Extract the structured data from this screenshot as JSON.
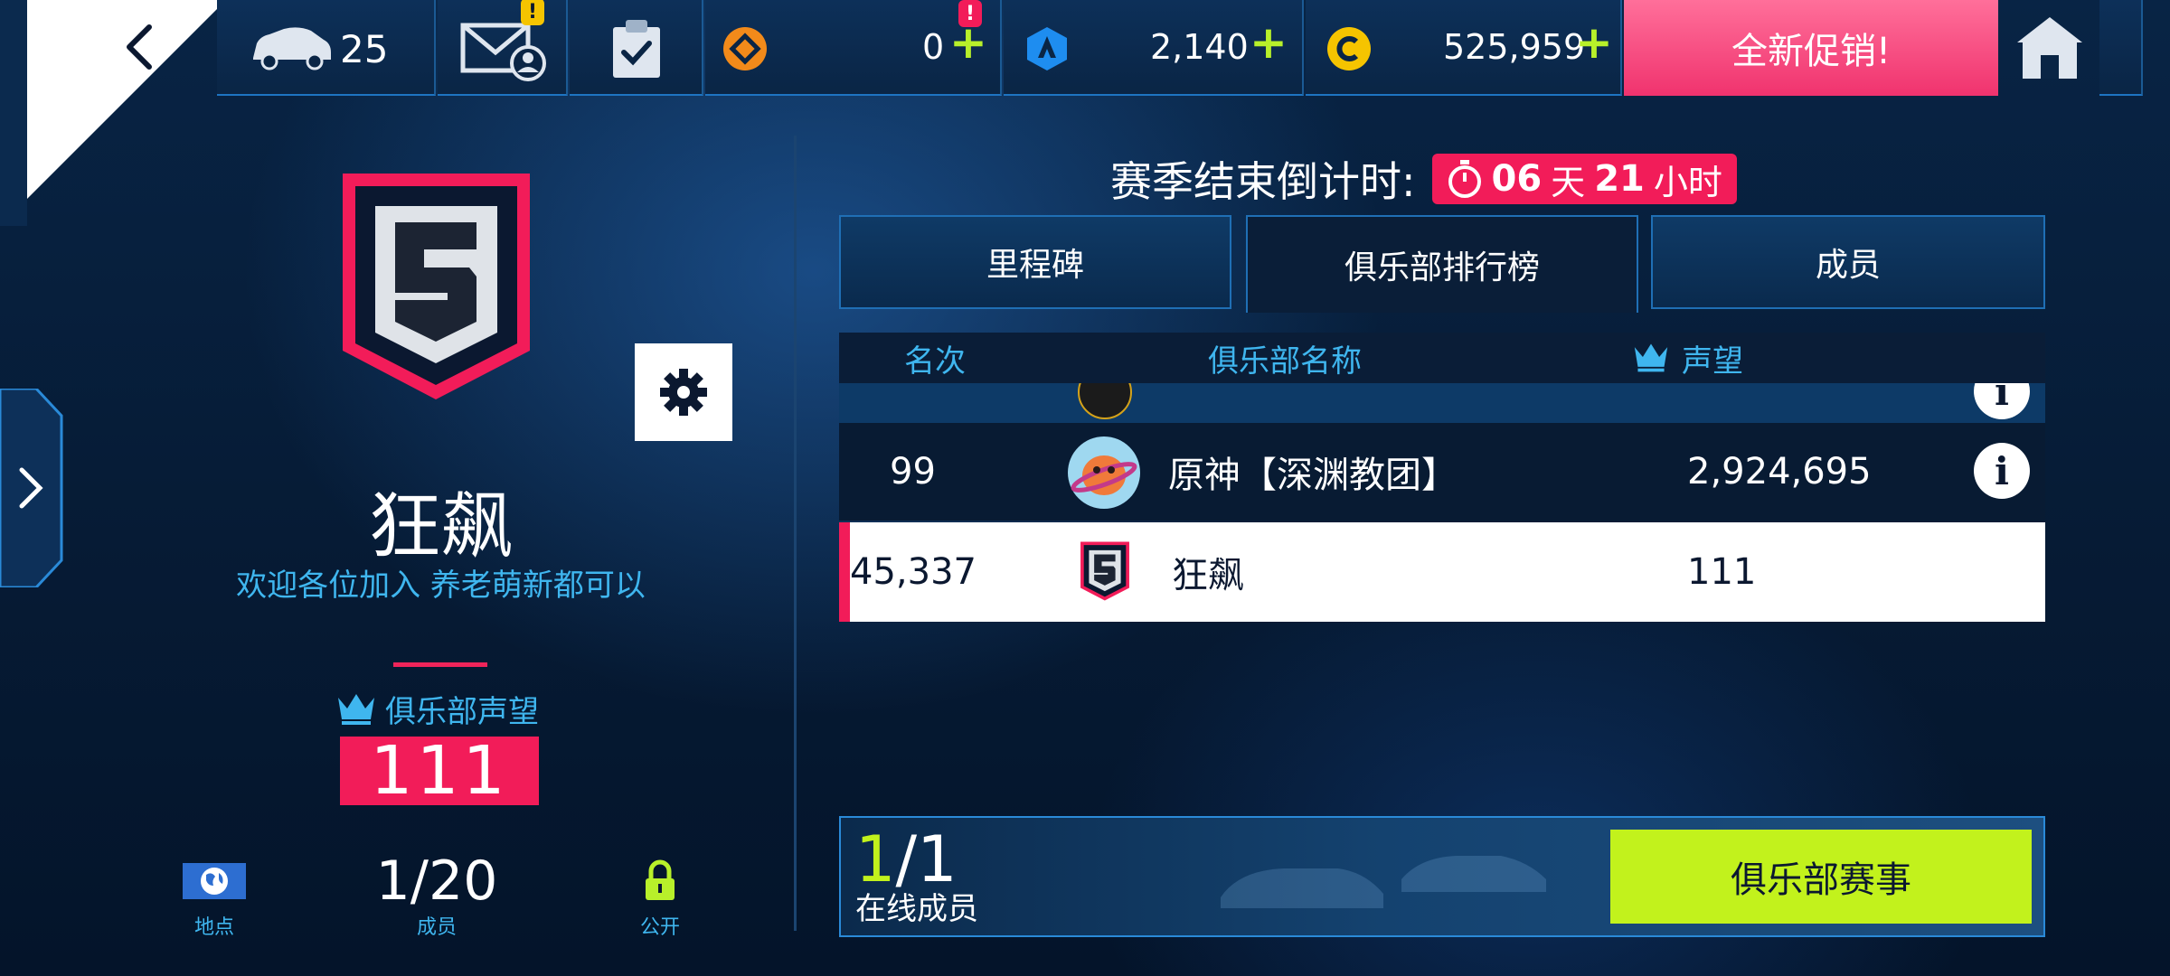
{
  "top_bar": {
    "cars_count": "25",
    "mail_alert": "!",
    "tokens_value": "0",
    "tokens_alert": "!",
    "blueprints_value": "2,140",
    "credits_value": "525,959",
    "plus": "+",
    "promo_label": "全新促销!"
  },
  "club": {
    "name": "狂飙",
    "motto": "欢迎各位加入 养老萌新都可以",
    "reputation_label": "俱乐部声望",
    "reputation_value": "111",
    "location_label": "地点",
    "members_value": "1/20",
    "members_label": "成员",
    "privacy_label": "公开"
  },
  "season": {
    "countdown_label": "赛季结束倒计时:",
    "days": "06",
    "days_unit": "天",
    "hours": "21",
    "hours_unit": "小时"
  },
  "tabs": [
    {
      "label": "里程碑",
      "active": false
    },
    {
      "label": "俱乐部排行榜",
      "active": true
    },
    {
      "label": "成员",
      "active": false
    }
  ],
  "leaderboard": {
    "headers": {
      "rank": "名次",
      "name": "俱乐部名称",
      "reputation": "声望"
    },
    "rows": [
      {
        "rank": "99",
        "name": "原神【深渊教团】",
        "reputation": "2,924,695"
      },
      {
        "rank": "45,337",
        "name": "狂飙",
        "reputation": "111"
      }
    ]
  },
  "online": {
    "online_num": "1",
    "total": "/1",
    "label": "在线成员"
  },
  "events_button": "俱乐部赛事",
  "colors": {
    "accent_pink": "#f21c59",
    "accent_lime": "#c2f21c",
    "accent_cyan": "#3fb6ef"
  }
}
